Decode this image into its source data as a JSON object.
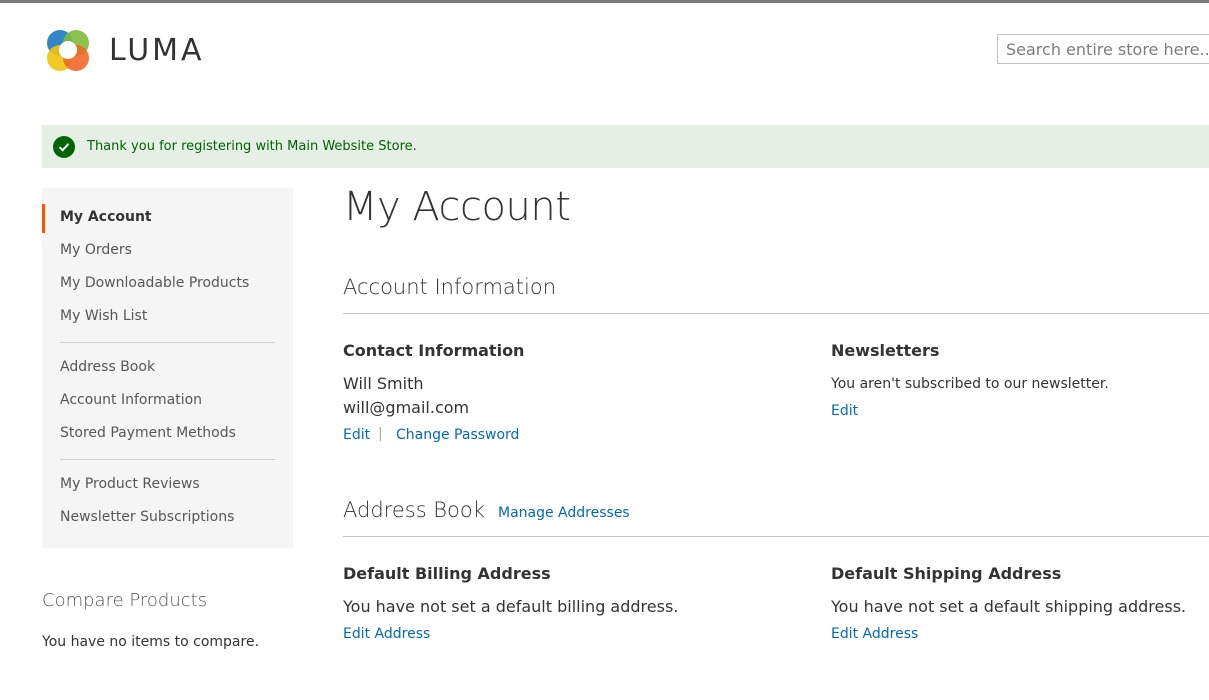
{
  "header": {
    "logo_text": "LUMA",
    "search_placeholder": "Search entire store here..."
  },
  "message": {
    "text": "Thank you for registering with Main Website Store.",
    "type": "success",
    "color": "#006400"
  },
  "sidebar": {
    "items": [
      {
        "label": "My Account",
        "current": true
      },
      {
        "label": "My Orders"
      },
      {
        "label": "My Downloadable Products"
      },
      {
        "label": "My Wish List"
      },
      {
        "label": "Address Book"
      },
      {
        "label": "Account Information"
      },
      {
        "label": "Stored Payment Methods"
      },
      {
        "label": "My Product Reviews"
      },
      {
        "label": "Newsletter Subscriptions"
      }
    ],
    "accent_color": "#ff5501"
  },
  "compare": {
    "title": "Compare Products",
    "empty_text": "You have no items to compare."
  },
  "main": {
    "title": "My Account",
    "account_info": {
      "title": "Account Information",
      "contact": {
        "title": "Contact Information",
        "name": "Will Smith",
        "email": "will@gmail.com",
        "edit_label": "Edit",
        "separator": "|",
        "change_password_label": "Change Password"
      },
      "newsletters": {
        "title": "Newsletters",
        "text": "You aren't subscribed to our newsletter.",
        "edit_label": "Edit"
      }
    },
    "address_book": {
      "title": "Address Book",
      "manage_label": "Manage Addresses",
      "billing": {
        "title": "Default Billing Address",
        "text": "You have not set a default billing address.",
        "edit_label": "Edit Address"
      },
      "shipping": {
        "title": "Default Shipping Address",
        "text": "You have not set a default shipping address.",
        "edit_label": "Edit Address"
      }
    }
  },
  "colors": {
    "link": "#006bb4",
    "message_bg": "#e5efe5"
  }
}
